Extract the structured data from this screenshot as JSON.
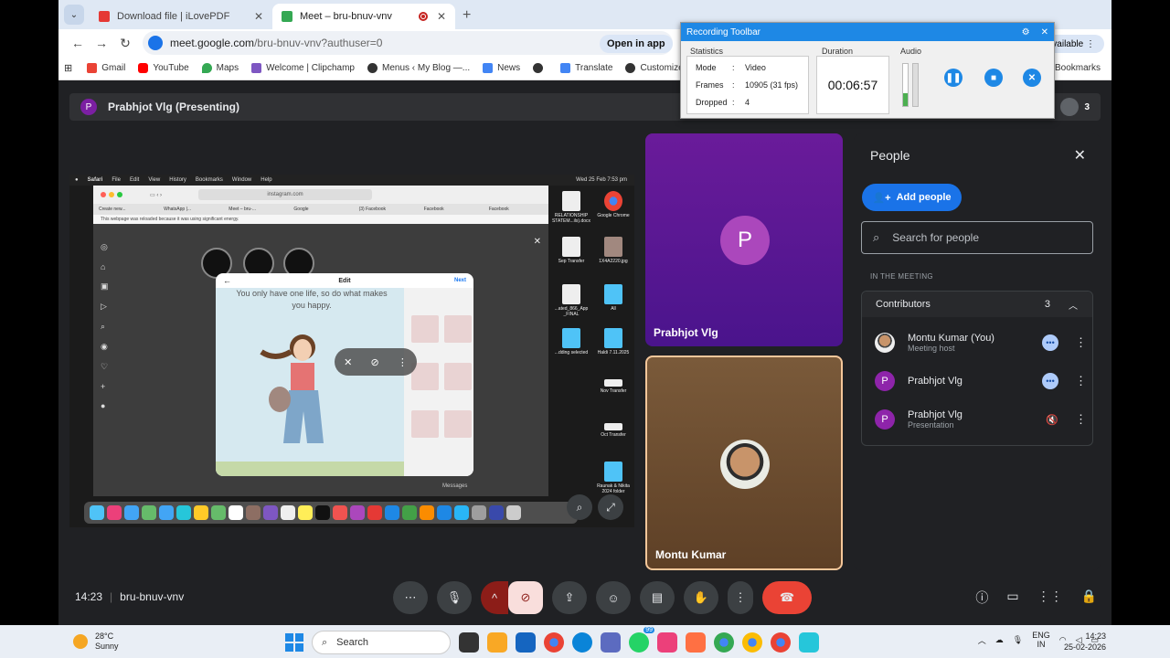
{
  "browser": {
    "tabs": [
      {
        "label": "Download file | iLovePDF",
        "active": false
      },
      {
        "label": "Meet – bru-bnuv-vnv",
        "active": true
      }
    ],
    "url_host": "meet.google.com",
    "url_path": "/bru-bnuv-vnv?authuser=0",
    "open_app_label": "Open in app",
    "available_label": "available",
    "bookmarks": [
      "Gmail",
      "YouTube",
      "Maps",
      "Welcome | Clipchamp",
      "Menus ‹ My Blog —...",
      "News",
      "",
      "Translate",
      "Customize: cellshop..."
    ],
    "all_bookmarks_label": "ll Bookmarks"
  },
  "recording_toolbar": {
    "title": "Recording Toolbar",
    "statistics_label": "Statistics",
    "rows": [
      {
        "key": "Mode",
        "value": "Video"
      },
      {
        "key": "Frames",
        "value": "10905 (31 fps)"
      },
      {
        "key": "Dropped",
        "value": "4"
      }
    ],
    "duration_label": "Duration",
    "duration": "00:06:57",
    "audio_label": "Audio"
  },
  "presenting_banner": {
    "avatar_letter": "P",
    "text": "Prabhjot Vlg (Presenting)",
    "participant_count": "3"
  },
  "shared_screen": {
    "menubar": [
      "Safari",
      "File",
      "Edit",
      "View",
      "History",
      "Bookmarks",
      "Window",
      "Help"
    ],
    "menubar_right": "Wed 25 Feb  7:53 pm",
    "url": "instagram.com",
    "tabs": [
      "Create new...",
      "WhatsApp |...",
      "Meet – bru-...",
      "Google",
      "(3) Facebook",
      "Facebook",
      "Facebook"
    ],
    "notice": "This webpage was reloaded because it was using significant energy.",
    "edit_title": "Edit",
    "next_label": "Next",
    "quote": "You only have one life, so do what makes you happy.",
    "messages_label": "Messages",
    "desktop_icons": [
      "RELATIONSHIP STATEM...ils).docx",
      "Google Chrome",
      "Sep Transfer",
      "1X4A2220.jpg",
      "...ated_866_App _FINAL",
      "All",
      "...dding selected",
      "Haldi 7.11.2025",
      "Nov Transfer",
      "Oct Transfer",
      "Raunak & Nikita 2024 folder"
    ]
  },
  "tiles": [
    {
      "name": "Prabhjot Vlg",
      "letter": "P"
    },
    {
      "name": "Montu Kumar"
    }
  ],
  "people_panel": {
    "title": "People",
    "add_people_label": "Add people",
    "search_placeholder": "Search for people",
    "section_label": "IN THE MEETING",
    "group_label": "Contributors",
    "group_count": "3",
    "people": [
      {
        "name": "Montu Kumar (You)",
        "sub": "Meeting host"
      },
      {
        "name": "Prabhjot Vlg",
        "sub": "",
        "letter": "P"
      },
      {
        "name": "Prabhjot Vlg",
        "sub": "Presentation",
        "letter": "P"
      }
    ]
  },
  "bottom": {
    "time": "14:23",
    "meeting_code": "bru-bnuv-vnv"
  },
  "taskbar": {
    "temperature": "28°C",
    "weather": "Sunny",
    "search_label": "Search",
    "lang_top": "ENG",
    "lang_bottom": "IN",
    "time": "14:23",
    "date": "25-02-2026",
    "badge": "99"
  },
  "colors": {
    "accent_blue": "#1a73e8",
    "end_call_red": "#ea4335",
    "presenter_purple": "#7b1fa2"
  }
}
